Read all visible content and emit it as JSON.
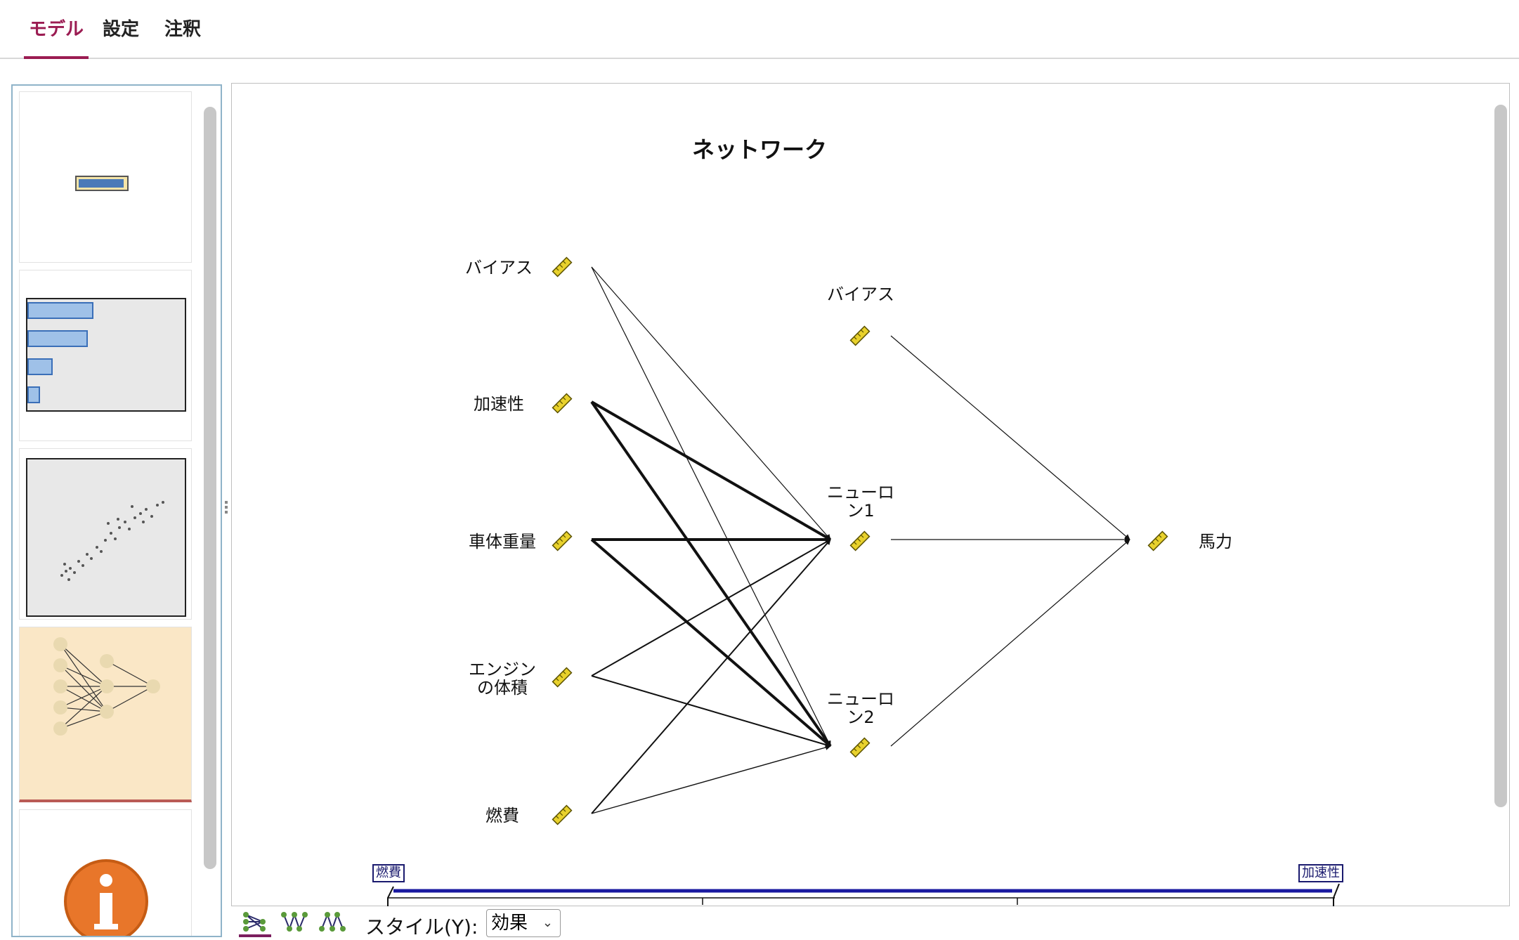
{
  "tabs": [
    {
      "label": "モデル",
      "active": true
    },
    {
      "label": "設定",
      "active": false
    },
    {
      "label": "注釈",
      "active": false
    }
  ],
  "network": {
    "title": "ネットワーク",
    "inputs": [
      "バイアス",
      "加速性",
      "車体重量",
      "エンジン\nの体積",
      "燃費"
    ],
    "hidden": [
      "バイアス",
      "ニューロ\nン1",
      "ニューロ\nン2"
    ],
    "output": "馬力"
  },
  "legend": {
    "left_label": "燃費",
    "right_label": "加速性"
  },
  "toolbar": {
    "style_label": "スタイル(Y):",
    "style_value": "効果",
    "icons": [
      "network-style-icon",
      "weights-style-icon",
      "tree-style-icon"
    ]
  },
  "colors": {
    "accent": "#9b1c52",
    "thumb_selected": "#fae7c6",
    "legend_line": "#1a1aa0",
    "measure_icon": "#e8d12c"
  }
}
